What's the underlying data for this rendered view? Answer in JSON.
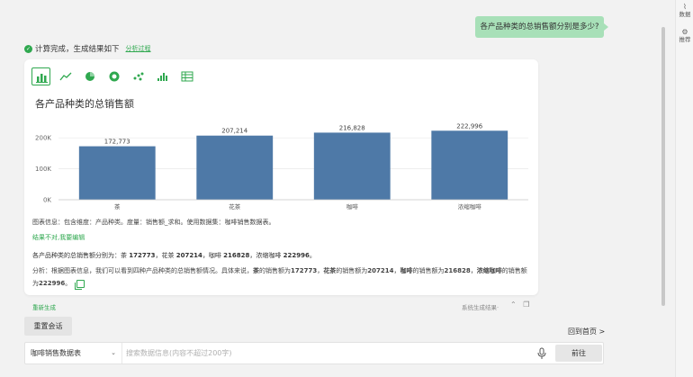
{
  "rail": {
    "items": [
      {
        "label": "数据",
        "icon": "pulse-icon"
      },
      {
        "label": "推荐",
        "icon": "gear-icon"
      }
    ]
  },
  "user_message": "各产品种类的总销售额分别是多少?",
  "status": {
    "text": "计算完成，生成结果如下",
    "link": "分析过程"
  },
  "chart_title": "各产品种类的总销售额",
  "chart_data": {
    "type": "bar",
    "title": "各产品种类的总销售额",
    "categories": [
      "茶",
      "花茶",
      "咖啡",
      "浓缩咖啡"
    ],
    "values": [
      172773,
      207214,
      216828,
      222996
    ],
    "value_labels": [
      "172,773",
      "207,214",
      "216,828",
      "222,996"
    ],
    "ylim": [
      0,
      250000
    ],
    "yticks": [
      0,
      100000,
      200000
    ],
    "ytick_labels": [
      "0K",
      "100K",
      "200K"
    ],
    "bar_color": "#4e79a7",
    "grid": true
  },
  "chart_info": "图表信息：包含维度：产品种类。度量：销售额_求和。使用数据集：咖啡销售数据表。",
  "edit_link": "结果不对,我要编辑",
  "summary": {
    "prefix": "各产品种类的总销售额分别为：",
    "items": [
      {
        "name": "茶",
        "value": "172773"
      },
      {
        "name": "花茶",
        "value": "207214"
      },
      {
        "name": "咖啡",
        "value": "216828"
      },
      {
        "name": "浓缩咖啡",
        "value": "222996"
      }
    ]
  },
  "analysis": {
    "prefix": "分析：根据图表信息，我们可以看到四种产品种类的总销售额情况。具体来说，",
    "items": [
      {
        "name": "茶",
        "value": "172773"
      },
      {
        "name": "花茶",
        "value": "207214"
      },
      {
        "name": "咖啡",
        "value": "216828"
      },
      {
        "name": "浓缩咖啡",
        "value": "222996"
      }
    ],
    "item_mid": "的销售额为",
    "sep": "，",
    "end": "。"
  },
  "footer": {
    "regen": "重新生成",
    "sys_note": "系统生成结果·"
  },
  "reset_button": "重置会话",
  "home_link": "回到首页 >",
  "input": {
    "dataset": "咖啡销售数据表",
    "placeholder": "搜索数据信息(内容不超过200字)",
    "value": "",
    "go_button": "前往"
  },
  "colors": {
    "accent": "#2fa84f",
    "bubble": "#a8e0b8"
  }
}
